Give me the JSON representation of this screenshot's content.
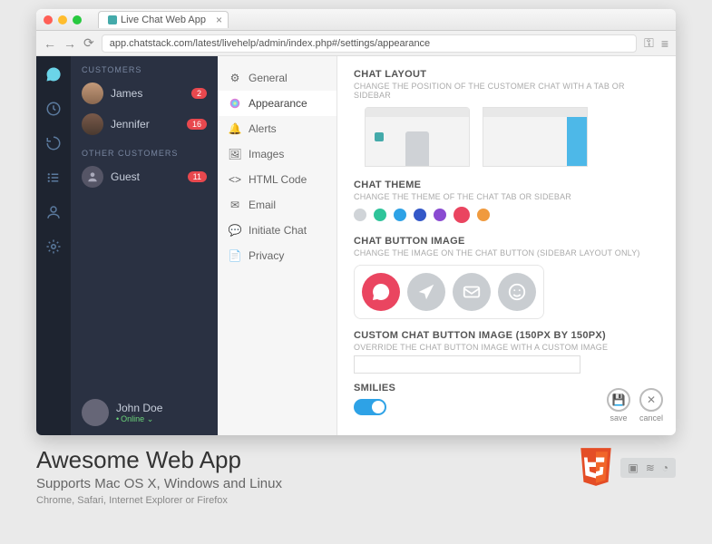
{
  "browser": {
    "tab_title": "Live Chat Web App",
    "url": "app.chatstack.com/latest/livehelp/admin/index.php#/settings/appearance"
  },
  "sidebar": {
    "section1_title": "CUSTOMERS",
    "section2_title": "OTHER CUSTOMERS",
    "customers": [
      {
        "name": "James",
        "badge": "2"
      },
      {
        "name": "Jennifer",
        "badge": "16"
      }
    ],
    "others": [
      {
        "name": "Guest",
        "badge": "11"
      }
    ],
    "user": {
      "name": "John Doe",
      "status": "Online"
    }
  },
  "settings_nav": {
    "items": [
      {
        "label": "General"
      },
      {
        "label": "Appearance"
      },
      {
        "label": "Alerts"
      },
      {
        "label": "Images"
      },
      {
        "label": "HTML Code"
      },
      {
        "label": "Email"
      },
      {
        "label": "Initiate Chat"
      },
      {
        "label": "Privacy"
      }
    ]
  },
  "content": {
    "layout": {
      "title": "CHAT LAYOUT",
      "sub": "CHANGE THE POSITION OF THE CUSTOMER CHAT WITH A TAB OR SIDEBAR"
    },
    "theme": {
      "title": "CHAT THEME",
      "sub": "CHANGE THE THEME OF THE CHAT TAB OR SIDEBAR"
    },
    "theme_colors": [
      "#d0d4d8",
      "#2fc49a",
      "#2ea2e6",
      "#3458c8",
      "#8a4bd1",
      "#ea4560",
      "#f09a3e"
    ],
    "button": {
      "title": "CHAT BUTTON IMAGE",
      "sub": "CHANGE THE IMAGE ON THE CHAT BUTTON (SIDEBAR LAYOUT ONLY)"
    },
    "custom": {
      "title": "CUSTOM CHAT BUTTON IMAGE (150PX BY 150PX)",
      "sub": "OVERRIDE THE CHAT BUTTON IMAGE WITH A CUSTOM IMAGE"
    },
    "smilies": {
      "title": "SMILIES"
    },
    "save_label": "save",
    "cancel_label": "cancel"
  },
  "promo": {
    "headline": "Awesome Web App",
    "sub1": "Supports Mac OS X, Windows and Linux",
    "sub2": "Chrome, Safari, Internet Explorer or Firefox"
  }
}
